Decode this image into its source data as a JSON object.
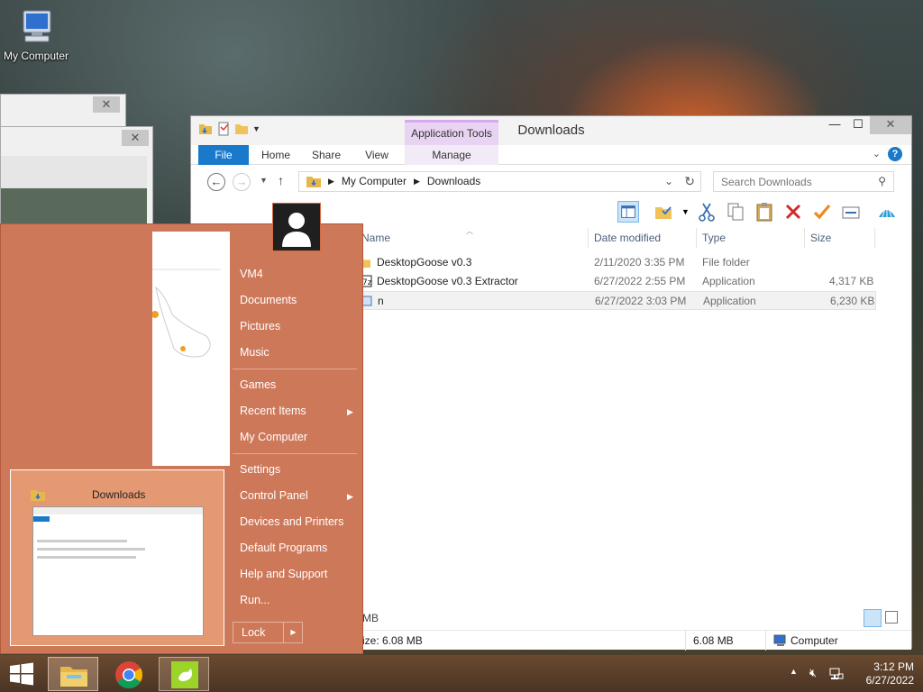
{
  "desktop": {
    "icon_label": "My Computer"
  },
  "explorer": {
    "title": "Downloads",
    "contextual_tab": "Application Tools",
    "tabs": [
      "File",
      "Home",
      "Share",
      "View",
      "Manage"
    ],
    "breadcrumb": [
      "My Computer",
      "Downloads"
    ],
    "search_placeholder": "Search Downloads",
    "columns": [
      "Name",
      "Date modified",
      "Type",
      "Size"
    ],
    "files": [
      {
        "name": "DesktopGoose v0.3",
        "date": "2/11/2020 3:35 PM",
        "type": "File folder",
        "size": ""
      },
      {
        "name": "DesktopGoose v0.3 Extractor",
        "date": "6/27/2022 2:55 PM",
        "type": "Application",
        "size": "4,317 KB"
      },
      {
        "name": "n",
        "date": "6/27/2022 3:03 PM",
        "type": "Application",
        "size": "6,230 KB"
      }
    ],
    "status": {
      "selection": "ize: 6.08 MB",
      "size": "6.08 MB",
      "location": "Computer",
      "behind_text": "MB"
    }
  },
  "start_menu": {
    "user": "VM4",
    "items": [
      {
        "label": "Documents"
      },
      {
        "label": "Pictures"
      },
      {
        "label": "Music"
      },
      {
        "label": "Games"
      },
      {
        "label": "Recent Items"
      },
      {
        "label": "My Computer"
      },
      {
        "label": "Settings"
      },
      {
        "label": "Control Panel"
      },
      {
        "label": "Devices and Printers"
      },
      {
        "label": "Default Programs"
      },
      {
        "label": "Help and Support"
      },
      {
        "label": "Run..."
      }
    ],
    "thumbnail_label": "Downloads",
    "lock_label": "Lock"
  },
  "taskbar": {
    "time": "3:12 PM",
    "date": "6/27/2022"
  },
  "colors": {
    "start_menu_bg": "#ce785a",
    "ribbon_file_tab": "#1979ca",
    "app_tools_accent": "#d8a9ee"
  }
}
